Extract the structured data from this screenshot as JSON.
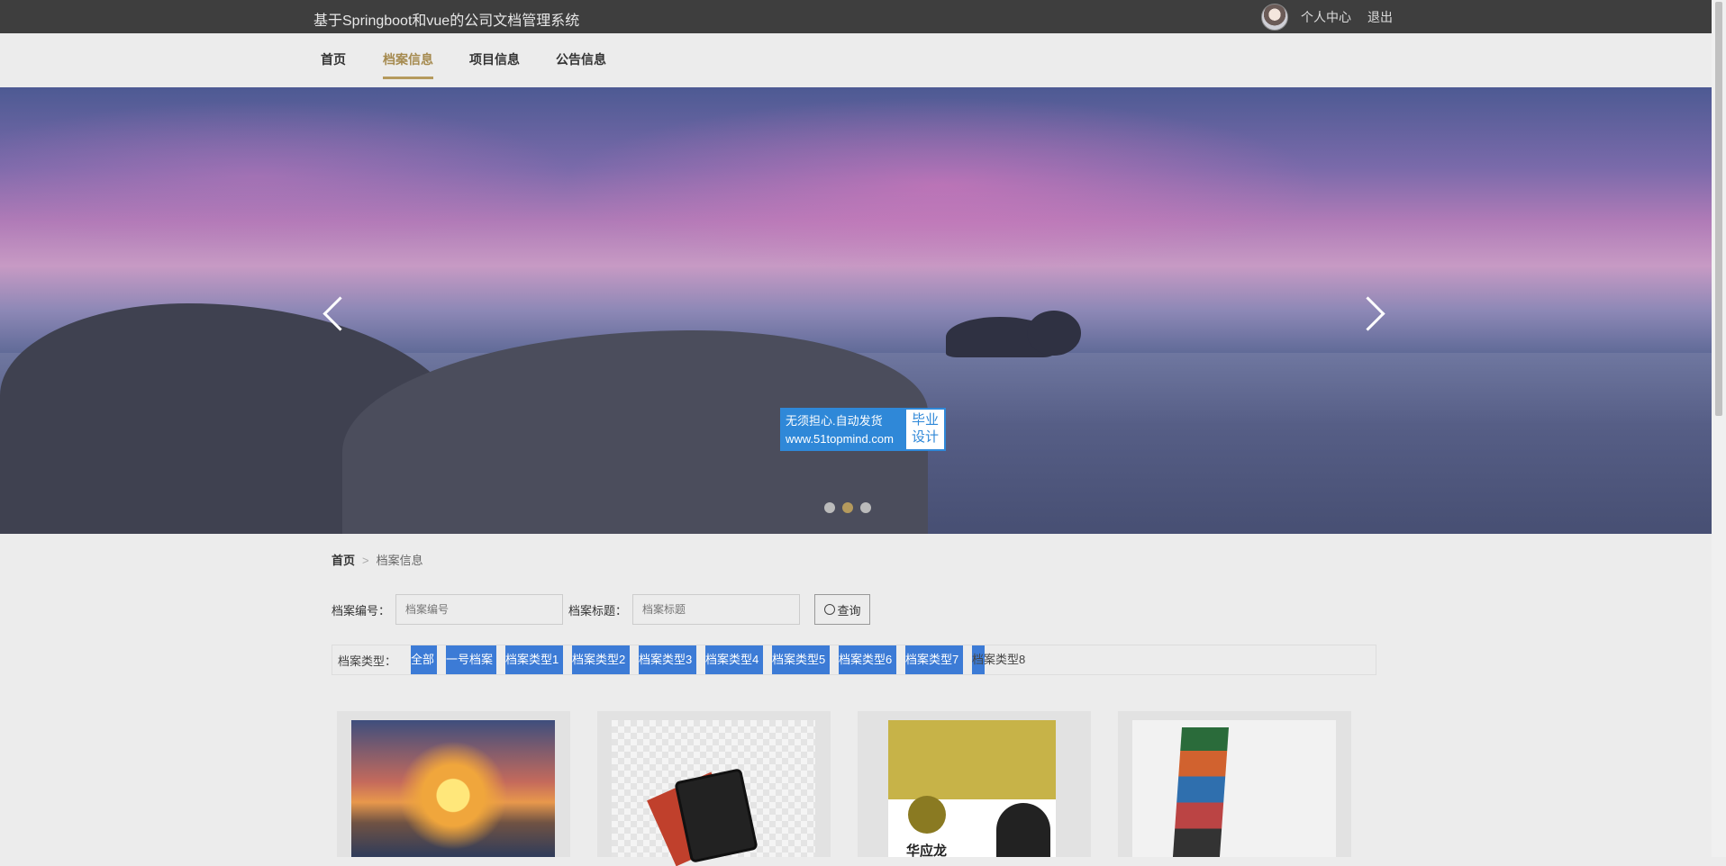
{
  "header": {
    "title": "基于Springboot和vue的公司文档管理系统",
    "personal_center": "个人中心",
    "logout": "退出"
  },
  "nav": {
    "items": [
      {
        "label": "首页"
      },
      {
        "label": "档案信息"
      },
      {
        "label": "项目信息"
      },
      {
        "label": "公告信息"
      }
    ],
    "active": "档案信息"
  },
  "banner": {
    "watermark_line1": "无须担心.自动发货",
    "watermark_line2": "www.51topmind.com",
    "watermark_right1": "毕业",
    "watermark_right2": "设计",
    "slides": 3,
    "active_slide": 2
  },
  "breadcrumb": {
    "home": "首页",
    "separator": ">",
    "current": "档案信息"
  },
  "search": {
    "code_label": "档案编号：",
    "code_placeholder": "档案编号",
    "title_label": "档案标题：",
    "title_placeholder": "档案标题",
    "query_button": "查询"
  },
  "types": {
    "label": "档案类型：",
    "tags": [
      "全部",
      "一号档案",
      "档案类型1",
      "档案类型2",
      "档案类型3",
      "档案类型4",
      "档案类型5",
      "档案类型6",
      "档案类型7",
      "档案类型8"
    ]
  },
  "cards": {
    "card3_name": "华应龙"
  },
  "colors": {
    "topbar": "#3e3e3e",
    "accent": "#b59a5d",
    "tag_blue": "#3c7bd6"
  }
}
